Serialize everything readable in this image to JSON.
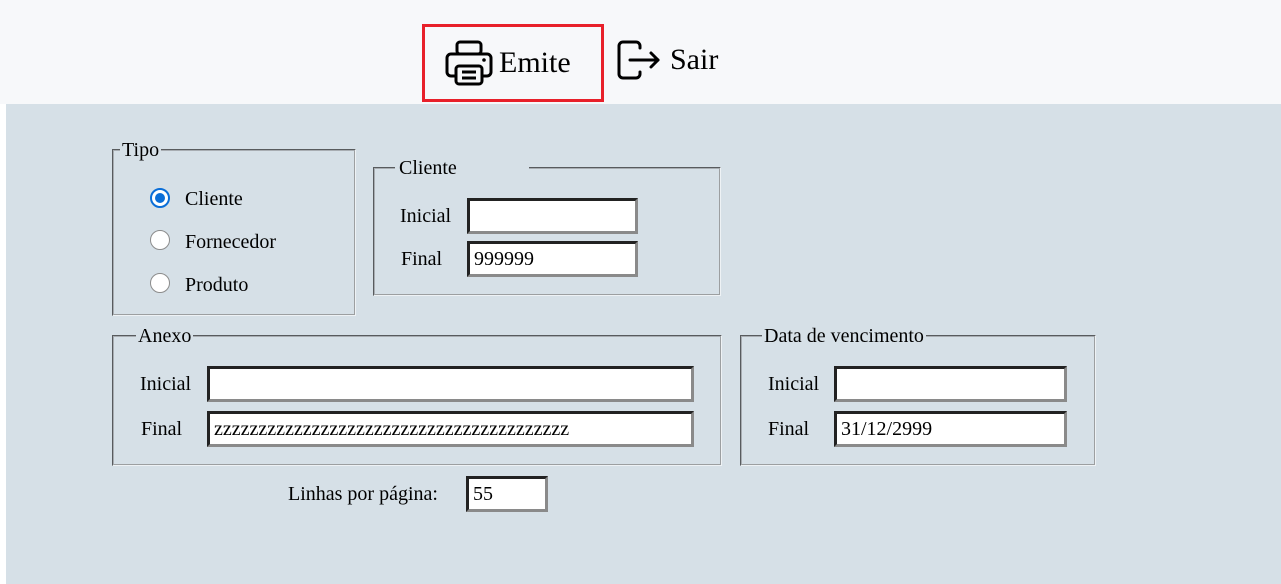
{
  "toolbar": {
    "emite_label": "Emite",
    "emite_icon": "printer-icon",
    "sair_label": "Sair",
    "sair_icon": "exit-icon",
    "highlight_color": "#e8202a"
  },
  "tipo": {
    "legend": "Tipo",
    "options": [
      "Cliente",
      "Fornecedor",
      "Produto"
    ],
    "selected": "Cliente"
  },
  "cliente": {
    "legend": "Cliente",
    "inicial_label": "Inicial",
    "inicial_value": "",
    "final_label": "Final",
    "final_value": "999999"
  },
  "anexo": {
    "legend": "Anexo",
    "inicial_label": "Inicial",
    "inicial_value": "",
    "final_label": "Final",
    "final_value": "zzzzzzzzzzzzzzzzzzzzzzzzzzzzzzzzzzzzzzzz"
  },
  "vencimento": {
    "legend": "Data de vencimento",
    "inicial_label": "Inicial",
    "inicial_value": "",
    "final_label": "Final",
    "final_value": "31/12/2999"
  },
  "linhas": {
    "label": "Linhas por página:",
    "value": "55"
  },
  "colors": {
    "background": "#d6e0e7",
    "toolbar_background": "#f7f8fa",
    "radio_accent": "#0a6ed8"
  }
}
